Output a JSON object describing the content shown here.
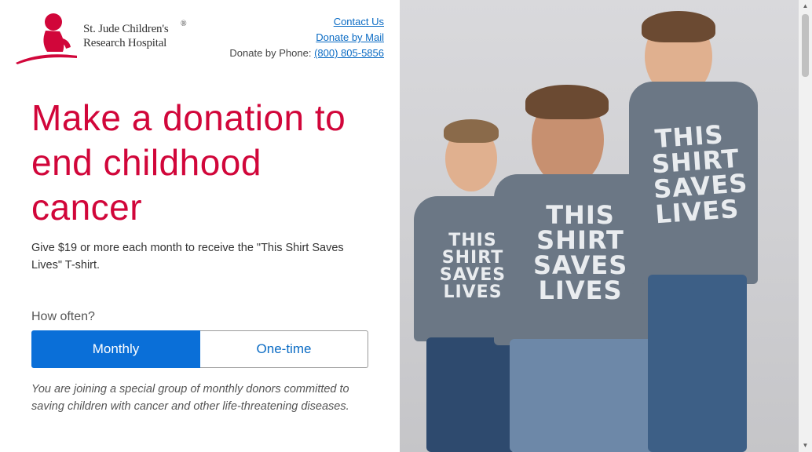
{
  "logo": {
    "line1": "St. Jude Children's",
    "line2": "Research Hospital",
    "reg": "®"
  },
  "header_links": {
    "contact": "Contact Us",
    "donate_mail": "Donate by Mail",
    "phone_label": "Donate by Phone:",
    "phone_number": "(800) 805-5856"
  },
  "hero": {
    "title": "Make a donation to end childhood cancer",
    "subtitle": "Give $19 or more each month to receive the \"This Shirt Saves Lives\" T-shirt."
  },
  "frequency": {
    "label": "How often?",
    "options": [
      "Monthly",
      "One-time"
    ],
    "selected": "Monthly",
    "note": "You are joining a special group of monthly donors committed to saving children with cancer and other life-threatening diseases."
  },
  "photo": {
    "shirt_text_lines": [
      "THIS",
      "SHIRT",
      "SAVES",
      "LIVES"
    ]
  },
  "colors": {
    "brand_red": "#d1063a",
    "accent_blue": "#0a6fd8"
  }
}
